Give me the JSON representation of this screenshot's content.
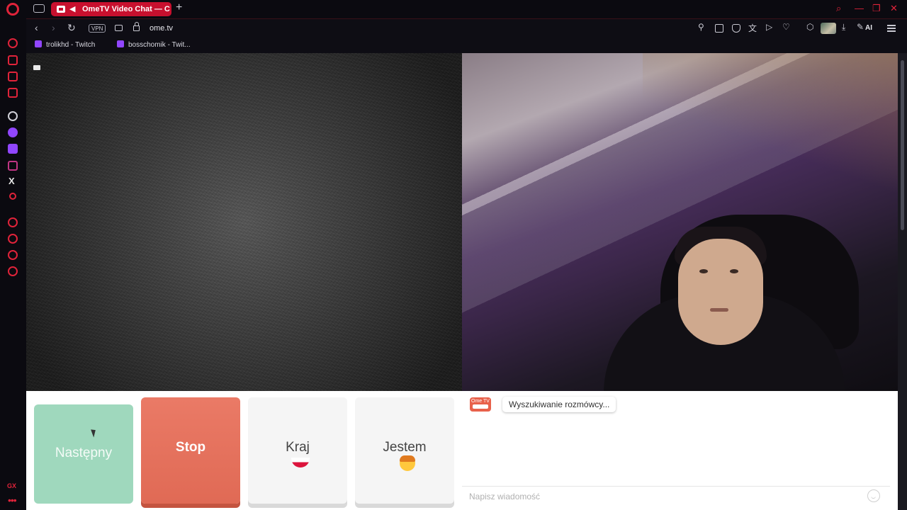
{
  "browser": {
    "tab_title": "OmeTV Video Chat — C",
    "new_tab_label": "+",
    "url": "ome.tv",
    "vpn_label": "VPN",
    "ai_label": "AI"
  },
  "bookmarks": [
    {
      "label": "trolikhd - Twitch"
    },
    {
      "label": "bosschomik - Twit..."
    }
  ],
  "sidebar": {
    "gx_label": "GX",
    "more_label": "•••",
    "x_label": "X"
  },
  "controls": {
    "next_label": "Następny",
    "stop_label": "Stop",
    "country_label": "Kraj",
    "gender_label": "Jestem"
  },
  "chat": {
    "logo_text": "Ome TV",
    "status_message": "Wyszukiwanie rozmówcy...",
    "input_placeholder": "Napisz wiadomość"
  },
  "colors": {
    "accent": "#e0233a",
    "next_button": "#9fd8bd",
    "stop_button": "#e06a55"
  }
}
